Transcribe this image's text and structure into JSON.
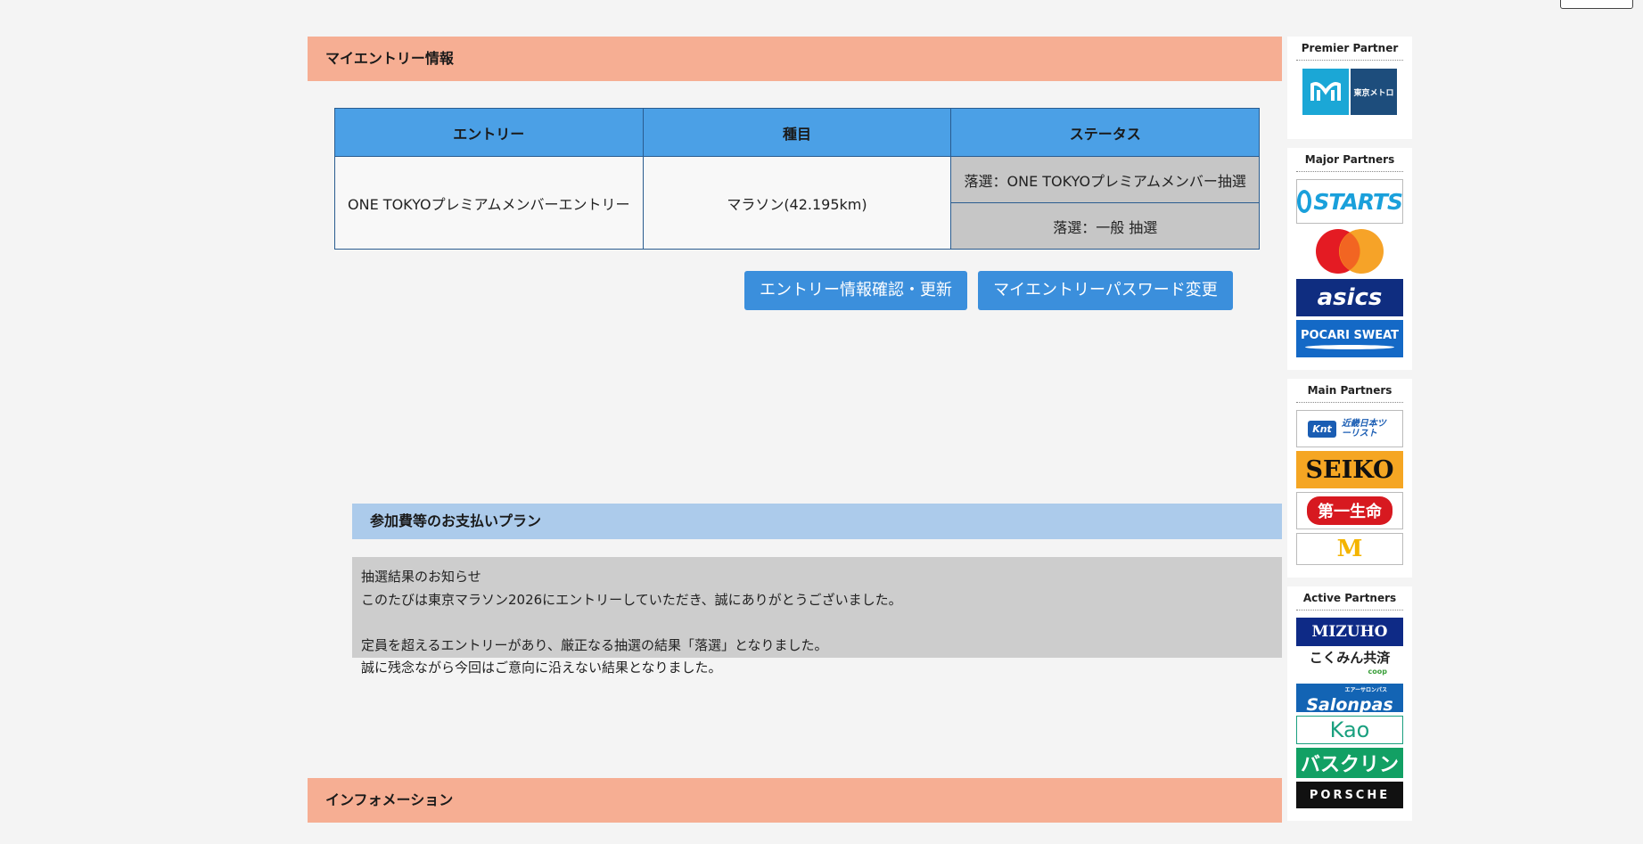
{
  "entry_section": {
    "title": "マイエントリー情報",
    "table": {
      "headers": [
        "エントリー",
        "種目",
        "ステータス"
      ],
      "entry": "ONE TOKYOプレミアムメンバーエントリー",
      "event": "マラソン(42.195km)",
      "statuses": [
        "落選：ONE TOKYOプレミアムメンバー抽選",
        "落選：一般 抽選"
      ]
    },
    "buttons": {
      "confirm": "エントリー情報確認・更新",
      "password": "マイエントリーパスワード変更"
    }
  },
  "payment_section": {
    "title": "参加費等のお支払いプラン",
    "notice": {
      "line1": "抽選結果のお知らせ",
      "line2": "このたびは東京マラソン2026にエントリーしていただき、誠にありがとうございました。",
      "line3": "定員を超えるエントリーがあり、厳正なる抽選の結果「落選」となりました。",
      "line4": "誠に残念ながら今回はご意向に沿えない結果となりました。"
    }
  },
  "info_section": {
    "title": "インフォメーション"
  },
  "sidebar": {
    "premier": {
      "title": "Premier Partner",
      "logos": [
        {
          "text": "東京メトロ"
        }
      ]
    },
    "major": {
      "title": "Major Partners",
      "logos": [
        {
          "text": "STARTS"
        },
        {
          "text": ""
        },
        {
          "text": "asics"
        },
        {
          "text": "POCARI SWEAT"
        }
      ]
    },
    "main": {
      "title": "Main Partners",
      "logos": [
        {
          "text": "近畿日本ツーリスト",
          "badge": "Knt"
        },
        {
          "text": "SEIKO"
        },
        {
          "text": "第一生命"
        },
        {
          "text": "M"
        }
      ]
    },
    "active": {
      "title": "Active Partners",
      "logos": [
        {
          "text": "MIZUHO"
        },
        {
          "text": "こくみん共済",
          "sub": "coop"
        },
        {
          "text": "Salonpas",
          "sub": "エアーサロンパス"
        },
        {
          "text": "Kao"
        },
        {
          "text": "バスクリン"
        },
        {
          "text": "PORSCHE"
        }
      ]
    }
  },
  "colors": {
    "section_header": "#f6ae93",
    "table_header": "#4ba0e6",
    "button": "#3b8fdc",
    "sub_header": "#accbeb",
    "notice_bg": "#cdcdcd"
  }
}
